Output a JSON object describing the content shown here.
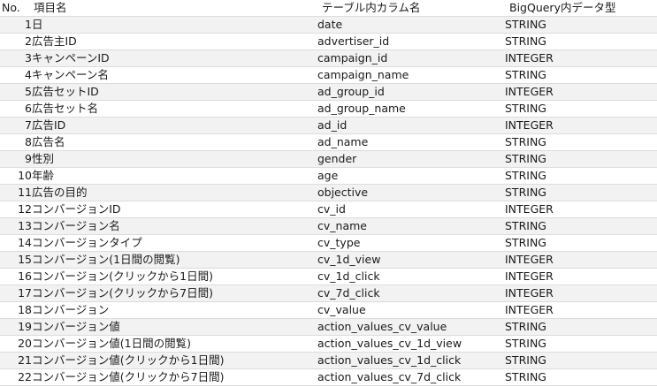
{
  "header": {
    "no": "No.",
    "item": "項目名",
    "column": "テーブル内カラム名",
    "type": "BigQuery内データ型"
  },
  "rows": [
    {
      "no": "1",
      "item": "日",
      "column": "date",
      "type": "STRING"
    },
    {
      "no": "2",
      "item": "広告主ID",
      "column": "advertiser_id",
      "type": "STRING"
    },
    {
      "no": "3",
      "item": "キャンペーンID",
      "column": "campaign_id",
      "type": "INTEGER"
    },
    {
      "no": "4",
      "item": "キャンペーン名",
      "column": "campaign_name",
      "type": "STRING"
    },
    {
      "no": "5",
      "item": "広告セットID",
      "column": "ad_group_id",
      "type": "INTEGER"
    },
    {
      "no": "6",
      "item": "広告セット名",
      "column": "ad_group_name",
      "type": "STRING"
    },
    {
      "no": "7",
      "item": "広告ID",
      "column": "ad_id",
      "type": "INTEGER"
    },
    {
      "no": "8",
      "item": "広告名",
      "column": "ad_name",
      "type": "STRING"
    },
    {
      "no": "9",
      "item": "性別",
      "column": "gender",
      "type": "STRING"
    },
    {
      "no": "10",
      "item": "年齢",
      "column": "age",
      "type": "STRING"
    },
    {
      "no": "11",
      "item": "広告の目的",
      "column": "objective",
      "type": "STRING"
    },
    {
      "no": "12",
      "item": "コンバージョンID",
      "column": "cv_id",
      "type": "INTEGER"
    },
    {
      "no": "13",
      "item": "コンバージョン名",
      "column": "cv_name",
      "type": "STRING"
    },
    {
      "no": "14",
      "item": "コンバージョンタイプ",
      "column": "cv_type",
      "type": "STRING"
    },
    {
      "no": "15",
      "item": "コンバージョン(1日間の閲覧)",
      "column": "cv_1d_view",
      "type": "INTEGER"
    },
    {
      "no": "16",
      "item": "コンバージョン(クリックから1日間)",
      "column": "cv_1d_click",
      "type": "INTEGER"
    },
    {
      "no": "17",
      "item": "コンバージョン(クリックから7日間)",
      "column": "cv_7d_click",
      "type": "INTEGER"
    },
    {
      "no": "18",
      "item": "コンバージョン",
      "column": "cv_value",
      "type": "INTEGER"
    },
    {
      "no": "19",
      "item": "コンバージョン値",
      "column": "action_values_cv_value",
      "type": "STRING"
    },
    {
      "no": "20",
      "item": "コンバージョン値(1日間の閲覧)",
      "column": "action_values_cv_1d_view",
      "type": "STRING"
    },
    {
      "no": "21",
      "item": "コンバージョン値(クリックから1日間)",
      "column": "action_values_cv_1d_click",
      "type": "STRING"
    },
    {
      "no": "22",
      "item": "コンバージョン値(クリックから7日間)",
      "column": "action_values_cv_7d_click",
      "type": "STRING"
    }
  ]
}
